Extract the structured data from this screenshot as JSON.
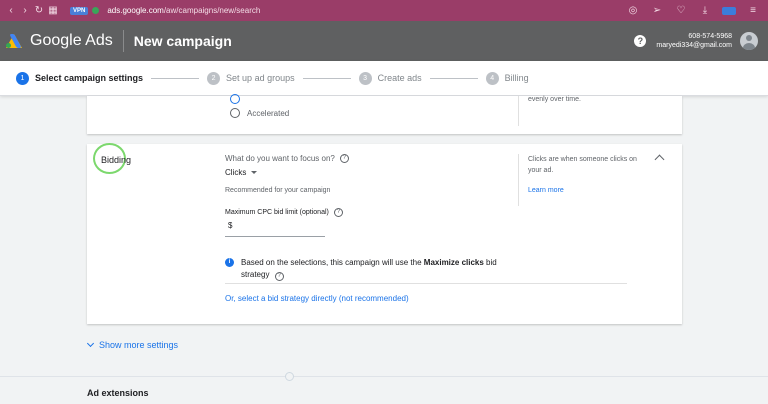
{
  "browser": {
    "vpn_label": "VPN",
    "url_host": "ads.google.com",
    "url_path": "/aw/campaigns/new/search"
  },
  "header": {
    "brand": "Google Ads",
    "title": "New campaign",
    "phone": "608-574-5968",
    "email": "maryedi334@gmail.com"
  },
  "steps": [
    {
      "num": "1",
      "label": "Select campaign settings"
    },
    {
      "num": "2",
      "label": "Set up ad groups"
    },
    {
      "num": "3",
      "label": "Create ads"
    },
    {
      "num": "4",
      "label": "Billing"
    }
  ],
  "delivery": {
    "option_accelerated": "Accelerated",
    "side_note": "evenly over time."
  },
  "bidding": {
    "title": "Bidding",
    "question": "What do you want to focus on?",
    "focus_value": "Clicks",
    "recommended": "Recommended for your campaign",
    "cpc_label": "Maximum CPC bid limit (optional)",
    "cpc_prefix": "$",
    "info_pre": "Based on the selections, this campaign will use the ",
    "info_bold": "Maximize clicks",
    "info_post": " bid",
    "info_line2": "strategy",
    "strategy_link": "Or, select a bid strategy directly (not recommended)",
    "side_note": "Clicks are when someone clicks on your ad.",
    "learn_more": "Learn more"
  },
  "show_more": "Show more settings",
  "ad_extensions": "Ad extensions"
}
